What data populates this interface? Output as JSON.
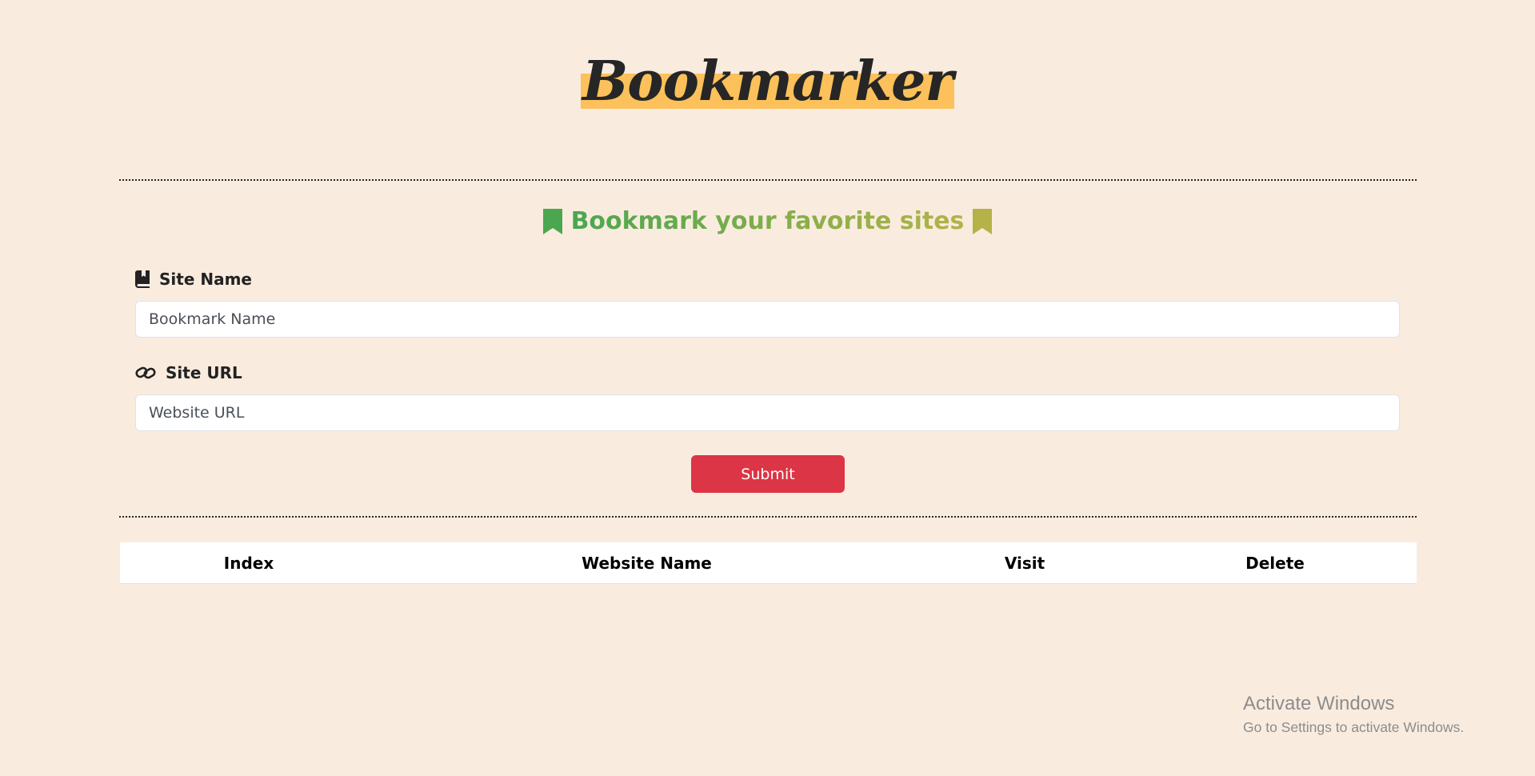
{
  "header": {
    "logo_text": "Bookmarker",
    "tagline": "Bookmark your favorite sites",
    "tagline_icon_left": "bookmark-icon",
    "tagline_icon_right": "bookmark-icon"
  },
  "form": {
    "site_name": {
      "label": "Site Name",
      "icon": "book-bookmark-icon",
      "placeholder": "Bookmark Name",
      "value": ""
    },
    "site_url": {
      "label": "Site URL",
      "icon": "link-icon",
      "placeholder": "Website URL",
      "value": ""
    },
    "submit_label": "Submit"
  },
  "table": {
    "columns": [
      "Index",
      "Website Name",
      "Visit",
      "Delete"
    ],
    "rows": []
  },
  "watermark": {
    "title": "Activate Windows",
    "subtitle": "Go to Settings to activate Windows."
  },
  "colors": {
    "background": "#f9ecdf",
    "logo_highlight": "#fcc15b",
    "tagline_start": "#4aa74f",
    "tagline_end": "#b5b347",
    "submit": "#dc3545"
  }
}
